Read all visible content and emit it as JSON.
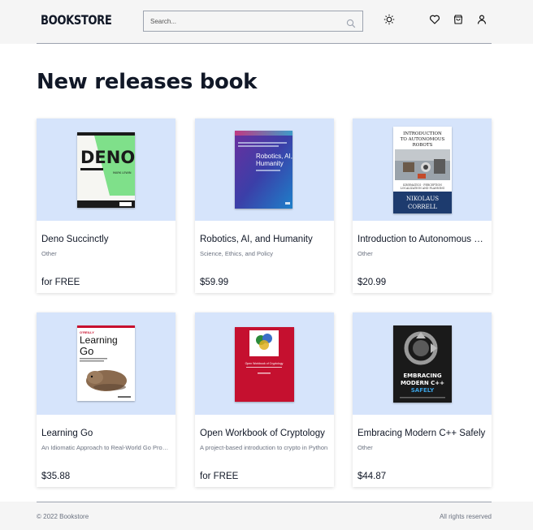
{
  "header": {
    "logo": "BOOKSTORE",
    "search_placeholder": "Search...",
    "icons": [
      "search-icon",
      "theme-toggle-icon",
      "heart-icon",
      "cart-icon",
      "user-icon"
    ]
  },
  "main": {
    "title": "New releases book",
    "books": [
      {
        "title": "Deno Succinctly",
        "subtitle": "Other",
        "price": "for FREE",
        "cover_text": "DENO",
        "cover_author": "MARK LEWIN"
      },
      {
        "title": "Robotics, AI, and Humanity",
        "subtitle": "Science, Ethics, and Policy",
        "price": "$59.99",
        "cover_text": "Robotics, AI, and Humanity"
      },
      {
        "title": "Introduction to Autonomous Robots",
        "subtitle": "Other",
        "price": "$20.99",
        "cover_text": "INTRODUCTION TO AUTONOMOUS ROBOTS",
        "cover_author": "NIKOLAUS CORRELL"
      },
      {
        "title": "Learning Go",
        "subtitle": "An Idiomatic Approach to Real-World Go Programming",
        "price": "$35.88",
        "cover_text": "Learning Go",
        "cover_publisher": "O'REILLY"
      },
      {
        "title": "Open Workbook of Cryptology",
        "subtitle": "A project-based introduction to crypto in Python",
        "price": "for FREE",
        "cover_text": "Open Workbook of Cryptology"
      },
      {
        "title": "Embracing Modern C++ Safely",
        "subtitle": "Other",
        "price": "$44.87",
        "cover_text": "EMBRACING MODERN C++ SAFELY"
      }
    ]
  },
  "footer": {
    "copyright": "© 2022 Bookstore",
    "rights": "All rights reserved"
  },
  "colors": {
    "cover_background": "#d6e4fb",
    "header_background": "#f5f5f5"
  }
}
